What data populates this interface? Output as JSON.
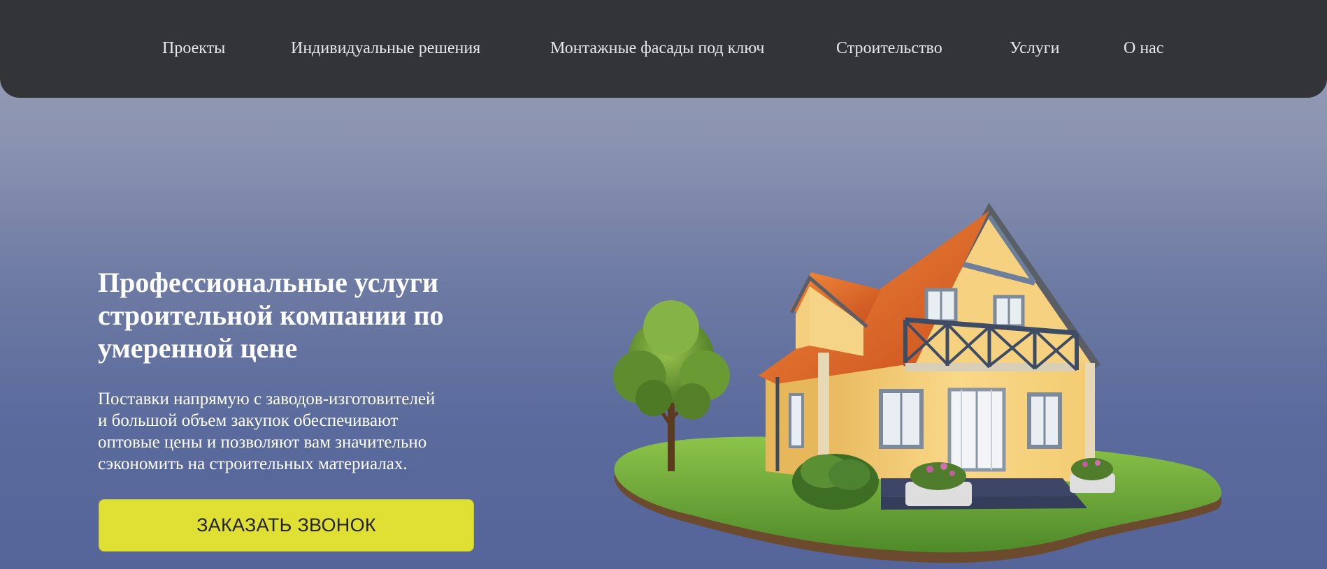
{
  "nav": {
    "items": [
      {
        "label": "Проекты"
      },
      {
        "label": "Индивидуальные решения"
      },
      {
        "label": "Монтажные фасады под ключ"
      },
      {
        "label": "Строительство"
      },
      {
        "label": "Услуги"
      },
      {
        "label": "О нас"
      }
    ]
  },
  "hero": {
    "title_lines": [
      "Профессиональные услуги",
      "строительной компании по",
      "умеренной цене"
    ],
    "text_lines": [
      "Поставки напрямую с заводов-изготовителей",
      "и большой объем закупок обеспечивают",
      "оптовые цены и позволяют вам значительно",
      "сэкономить на строительных материалах."
    ],
    "cta_label": "ЗАКАЗАТЬ ЗВОНОК"
  },
  "colors": {
    "navbar_bg": "#333438",
    "cta_bg": "#dfdf34",
    "wall": "#f7d27a",
    "roof": "#e0652a",
    "grass": "#6aa63a"
  },
  "icons": {
    "illustration": "house-with-tree-illustration"
  }
}
